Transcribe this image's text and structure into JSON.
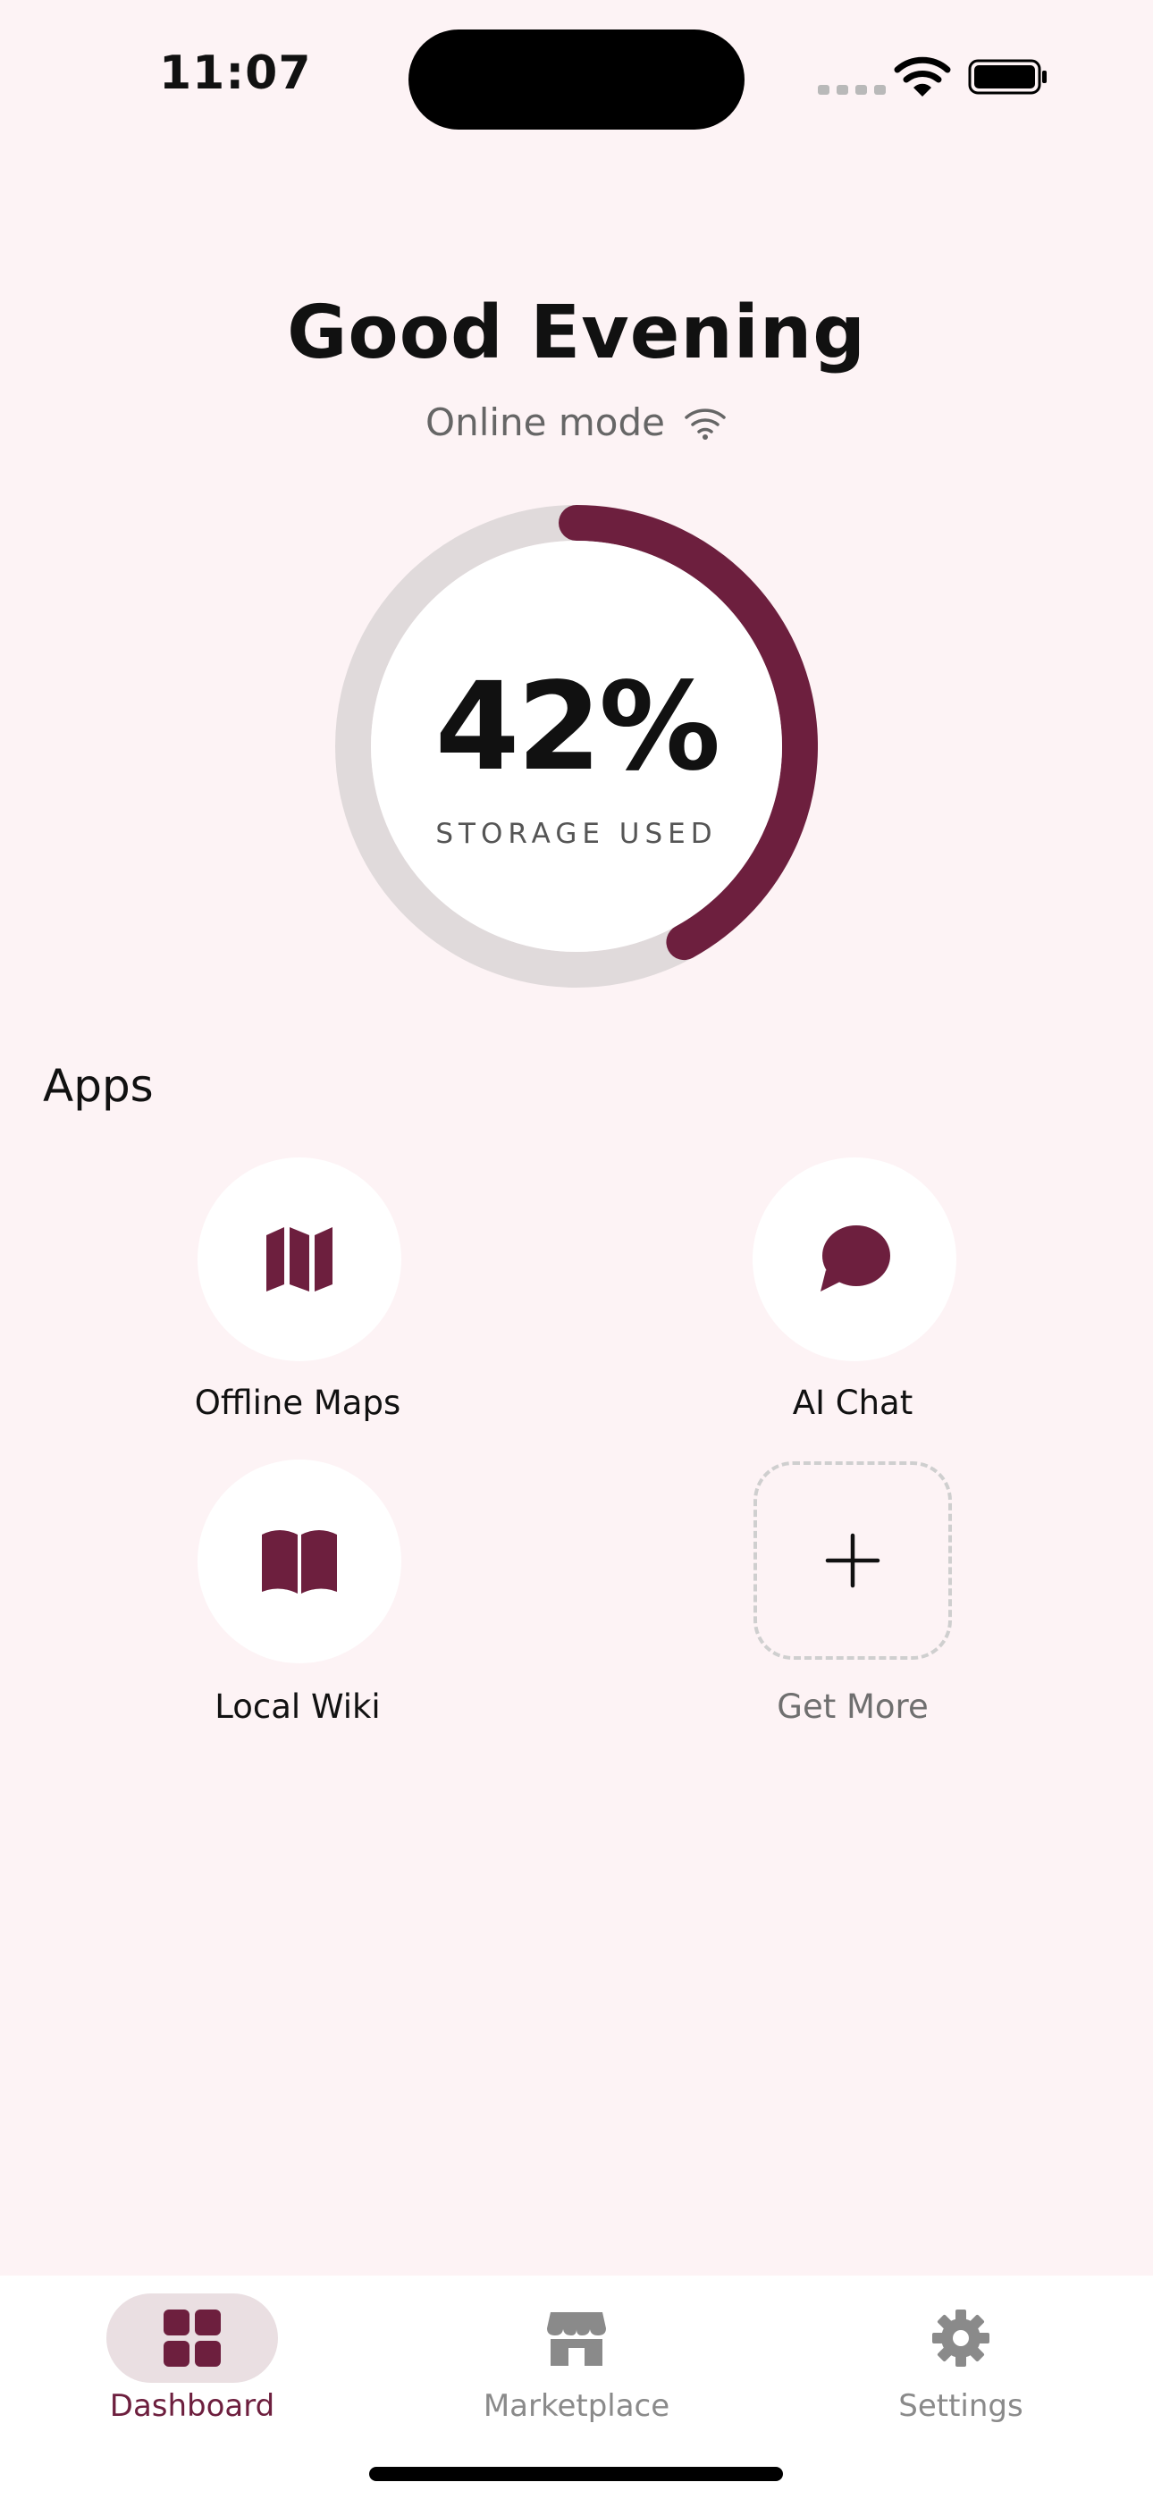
{
  "status_bar": {
    "time": "11:07"
  },
  "header": {
    "greeting": "Good Evening",
    "mode_text": "Online mode"
  },
  "storage": {
    "value_text": "42%",
    "percent_used": 42,
    "label": "STORAGE USED"
  },
  "apps": {
    "heading": "Apps",
    "items": [
      {
        "label": "Offline Maps",
        "icon": "map-icon"
      },
      {
        "label": "AI Chat",
        "icon": "chat-bubble-icon"
      },
      {
        "label": "Local Wiki",
        "icon": "book-icon"
      },
      {
        "label": "Get More",
        "icon": "plus-icon"
      }
    ]
  },
  "tab_bar": {
    "tabs": [
      {
        "label": "Dashboard",
        "icon": "grid-icon",
        "active": true
      },
      {
        "label": "Marketplace",
        "icon": "store-icon",
        "active": false
      },
      {
        "label": "Settings",
        "icon": "gear-icon",
        "active": false
      }
    ]
  },
  "colors": {
    "accent": "#6d1f3e",
    "background": "#fdf3f5",
    "ring_track": "#e0dadb",
    "muted_text": "#666666"
  }
}
